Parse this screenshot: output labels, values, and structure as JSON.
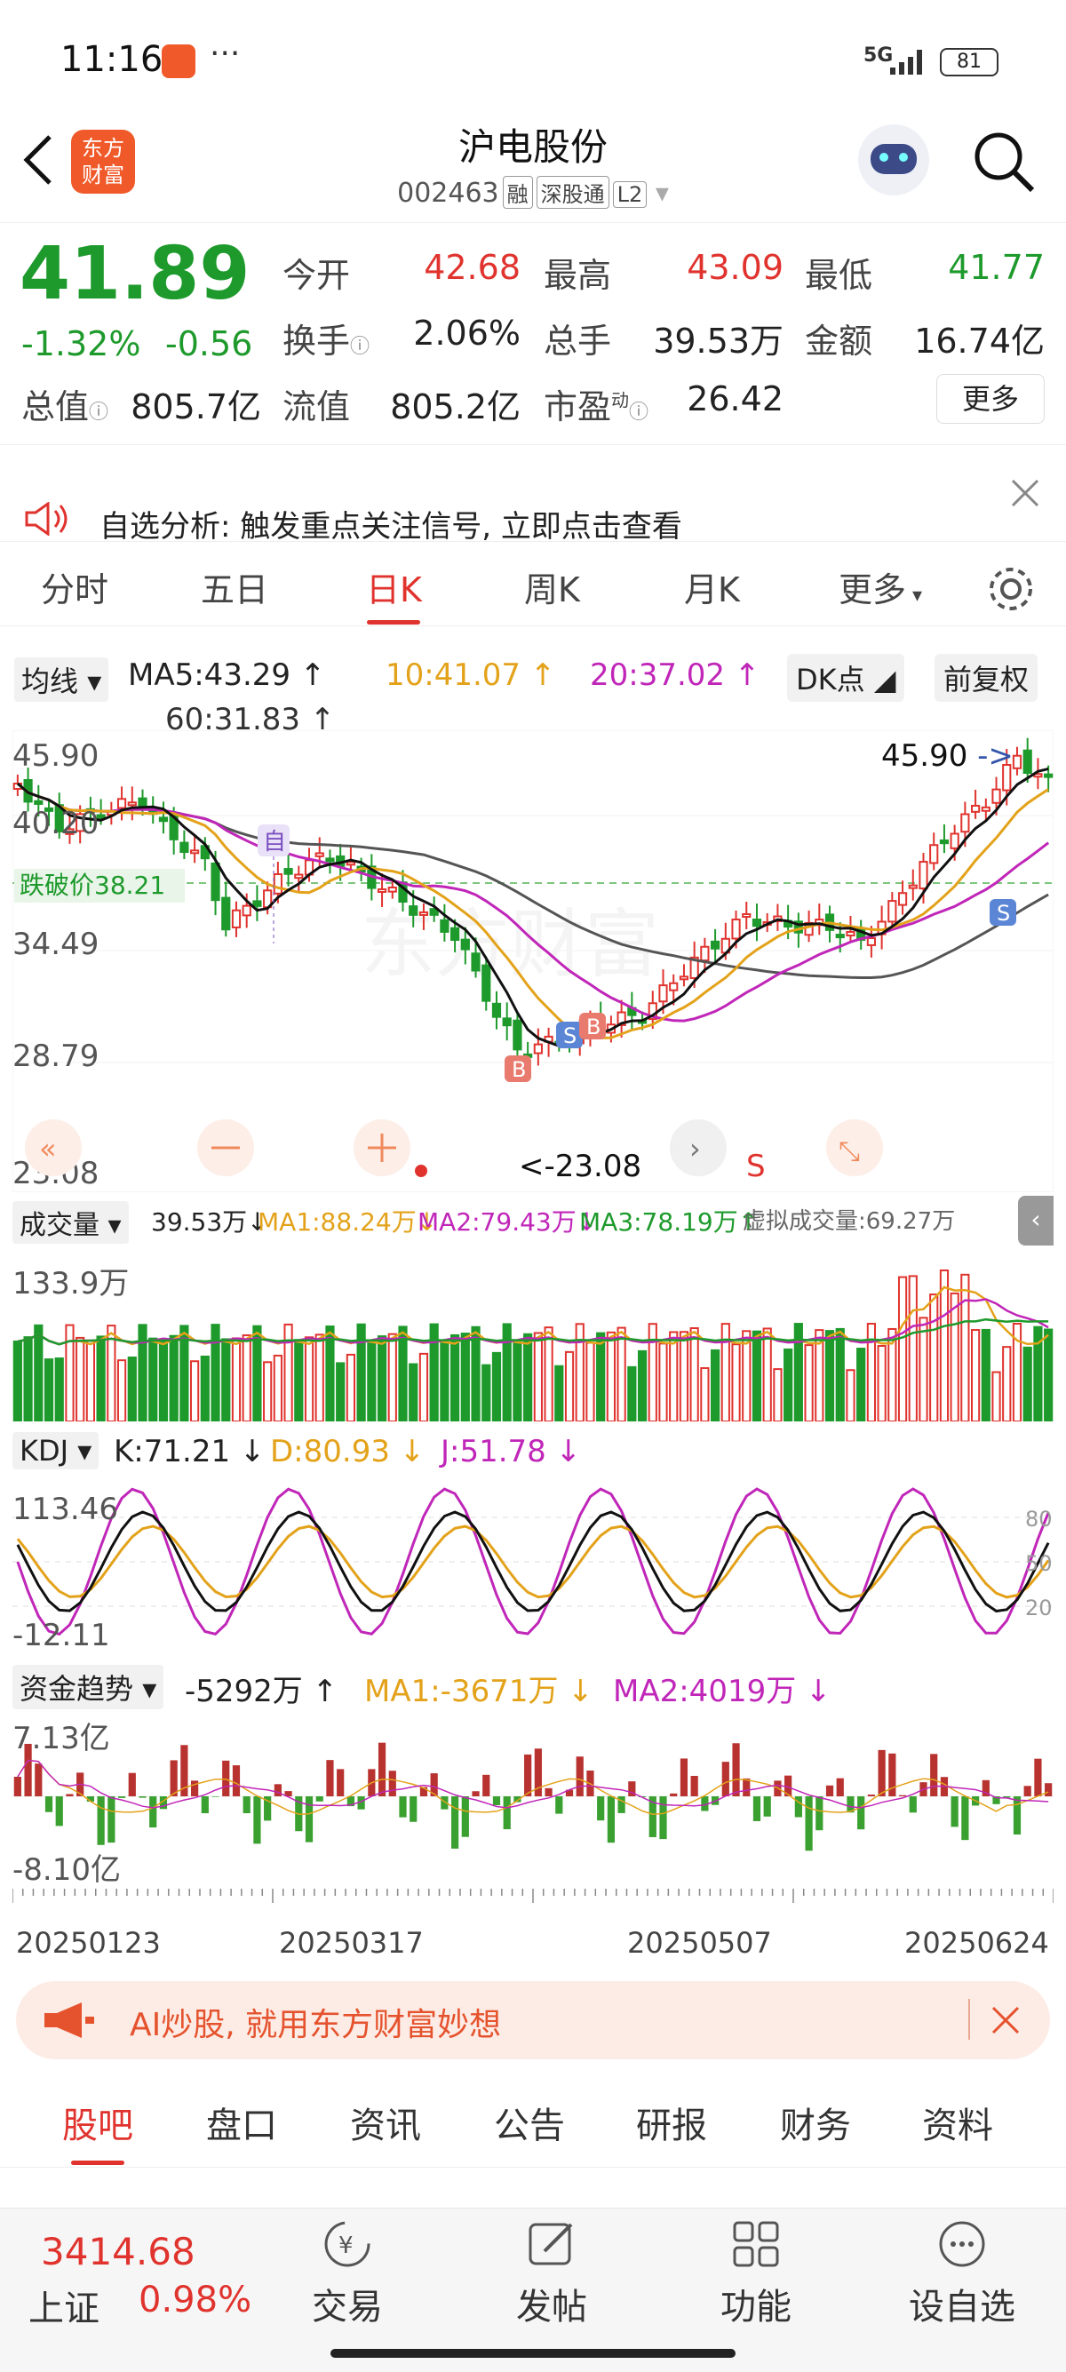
{
  "status": {
    "time": "11:16",
    "signal": "5G",
    "battery": "81",
    "more": "···"
  },
  "header": {
    "title": "沪电股份",
    "code": "002463",
    "tags": [
      "融",
      "深股通",
      "L2"
    ],
    "logo_text": [
      "东方",
      "财富"
    ]
  },
  "quote": {
    "price": "41.89",
    "pct": "-1.32%",
    "chg": "-0.56",
    "open_label": "今开",
    "open": "42.68",
    "high_label": "最高",
    "high": "43.09",
    "low_label": "最低",
    "low": "41.77",
    "turnover_label": "换手",
    "turnover": "2.06%",
    "vol_label": "总手",
    "vol": "39.53万",
    "amount_label": "金额",
    "amount": "16.74亿",
    "mcap_label": "总值",
    "mcap": "805.7亿",
    "float_label": "流值",
    "float": "805.2亿",
    "pe_label": "市盈",
    "pe_sup": "动",
    "pe": "26.42",
    "more": "更多"
  },
  "notice": {
    "text": "自选分析: 触发重点关注信号, 立即点击查看"
  },
  "tabs": [
    "分时",
    "五日",
    "日K",
    "周K",
    "月K",
    "更多"
  ],
  "ma": {
    "label": "均线",
    "ma5": "MA5:43.29",
    "ma10": "10:41.07",
    "ma20": "20:37.02",
    "ma60": "60:31.83",
    "dk": "DK点",
    "restore": "前复权"
  },
  "kline": {
    "y_labels": [
      "45.90",
      "40.20",
      "34.49",
      "28.79",
      "23.08"
    ],
    "max_label": "45.90",
    "min_label": "<-23.08",
    "break_label": "跌破价38.21",
    "watermark": "东方财富",
    "markers": {
      "zi": "自",
      "b": "B",
      "s": "S"
    }
  },
  "volume": {
    "label": "成交量",
    "v": "39.53万",
    "ma1": "MA1:88.24万",
    "ma2": "MA2:79.43万",
    "ma3": "MA3:78.19万",
    "virtual": "虚拟成交量:69.27万",
    "top": "133.9万"
  },
  "kdj": {
    "label": "KDJ",
    "k": "K:71.21",
    "d": "D:80.93",
    "j": "J:51.78",
    "top": "113.46",
    "bottom": "-12.11",
    "lines": [
      "80",
      "50",
      "20"
    ]
  },
  "fund": {
    "label": "资金趋势",
    "v": "-5292万",
    "ma1": "MA1:-3671万",
    "ma2": "MA2:4019万",
    "top": "7.13亿",
    "bottom": "-8.10亿"
  },
  "dates": [
    "20250123",
    "20250317",
    "20250507",
    "20250624"
  ],
  "banner": {
    "text": "AI炒股, 就用东方财富妙想"
  },
  "bottom_tabs": [
    "股吧",
    "盘口",
    "资讯",
    "公告",
    "研报",
    "财务",
    "资料"
  ],
  "bottom_nav": {
    "index_value": "3414.68",
    "index_name": "上证",
    "index_pct": "0.98%",
    "items": [
      "交易",
      "发帖",
      "功能",
      "设自选"
    ]
  },
  "colors": {
    "up": "#e0332e",
    "down": "#1e9a2c",
    "ma5": "#111111",
    "ma10": "#e3a21a",
    "ma20": "#c026b8",
    "ma60": "#555555"
  }
}
